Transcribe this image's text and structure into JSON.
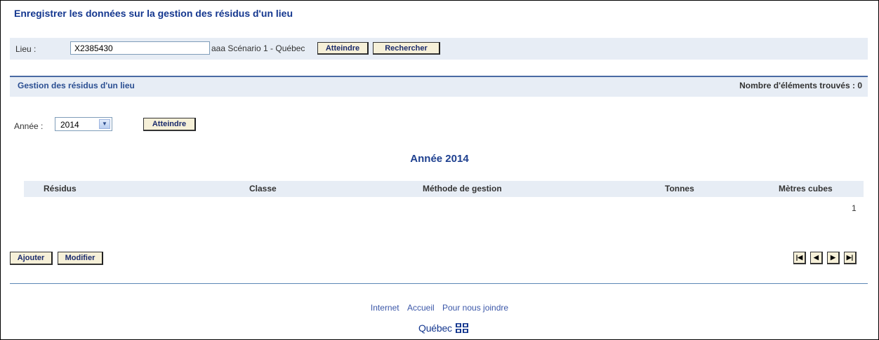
{
  "page_title": "Enregistrer les données sur la gestion des résidus d'un lieu",
  "lieu": {
    "label": "Lieu :",
    "input_value": "X2385430",
    "description": "aaa Scénario 1 - Québec",
    "btn_atteindre": "Atteindre",
    "btn_rechercher": "Rechercher"
  },
  "section": {
    "title": "Gestion des résidus d'un lieu",
    "count_text": "Nombre d'éléments trouvés : 0"
  },
  "annee": {
    "label": "Année :",
    "selected": "2014",
    "btn_atteindre": "Atteindre"
  },
  "year_heading": "Année 2014",
  "table": {
    "columns": [
      "Résidus",
      "Classe",
      "Méthode de gestion",
      "Tonnes",
      "Mètres cubes"
    ],
    "page_number": "1"
  },
  "actions": {
    "ajouter": "Ajouter",
    "modifier": "Modifier"
  },
  "pagination": {
    "first": "|◀",
    "prev": "◀",
    "next": "▶",
    "last": "▶|"
  },
  "footer": {
    "links": [
      "Internet",
      "Accueil",
      "Pour nous joindre"
    ],
    "logo_text": "Québec"
  },
  "colors": {
    "title": "#14378f",
    "bar_bg": "#e7edf5",
    "button_bg": "#f6f0d8",
    "link": "#3b57a8"
  }
}
